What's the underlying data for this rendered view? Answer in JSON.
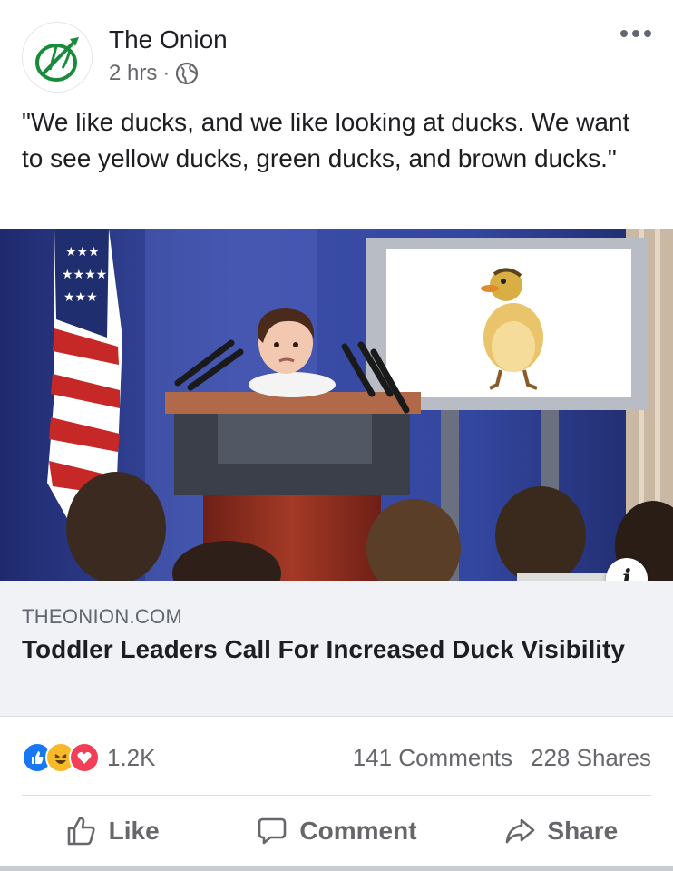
{
  "post": {
    "page_name": "The Onion",
    "time": "2 hrs",
    "separator": "·",
    "audience_icon": "globe-icon",
    "caption": "\"We like ducks, and we like looking at ducks. We want to see yellow ducks, green ducks, and brown ducks.\""
  },
  "link": {
    "domain": "THEONION.COM",
    "headline": "Toddler Leaders Call For Increased Duck Visibility",
    "info_label": "i"
  },
  "stats": {
    "reaction_icons": [
      "like-reaction-icon",
      "haha-reaction-icon",
      "love-reaction-icon"
    ],
    "reactions_count": "1.2K",
    "comments": "141 Comments",
    "shares": "228 Shares"
  },
  "actions": {
    "like": "Like",
    "comment": "Comment",
    "share": "Share"
  },
  "colors": {
    "brand_green": "#1a8a3c",
    "like_blue": "#1877f2",
    "haha_yellow": "#f7b928",
    "love_red": "#f33e58",
    "text_secondary": "#65676b"
  }
}
